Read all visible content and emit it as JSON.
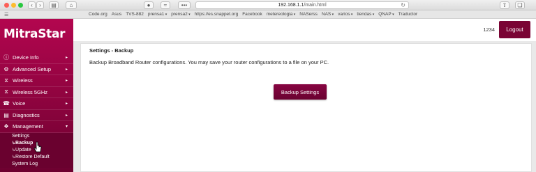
{
  "browser": {
    "url_host": "192.168.1.1",
    "url_path": "/main.html",
    "bookmarks": [
      {
        "label": "Code.org",
        "menu": false
      },
      {
        "label": "Asus",
        "menu": false
      },
      {
        "label": "TVS-882",
        "menu": false
      },
      {
        "label": "prensa1",
        "menu": true
      },
      {
        "label": "prensa2",
        "menu": true
      },
      {
        "label": "https://es.snappet.org",
        "menu": false
      },
      {
        "label": "Facebook",
        "menu": false
      },
      {
        "label": "metereologia",
        "menu": true
      },
      {
        "label": "NASerss",
        "menu": false
      },
      {
        "label": "NAS",
        "menu": true
      },
      {
        "label": "varios",
        "menu": true
      },
      {
        "label": "tiendas",
        "menu": true
      },
      {
        "label": "QNAP",
        "menu": true
      },
      {
        "label": "Traductor",
        "menu": false
      }
    ]
  },
  "brand": {
    "logo": "MitraStar",
    "color": "#a1044a"
  },
  "sidebar": {
    "items": [
      {
        "label": "Device Info",
        "icon": "info-icon"
      },
      {
        "label": "Advanced Setup",
        "icon": "gears-icon"
      },
      {
        "label": "Wireless",
        "icon": "wifi-icon"
      },
      {
        "label": "Wireless 5GHz",
        "icon": "wifi-icon"
      },
      {
        "label": "Voice",
        "icon": "phone-icon"
      },
      {
        "label": "Diagnostics",
        "icon": "chart-icon"
      },
      {
        "label": "Management",
        "icon": "wrench-icon"
      }
    ],
    "submenu": {
      "settings": "Settings",
      "backup": "Backup",
      "update": "Update",
      "restore": "Restore Default",
      "system_log": "System Log"
    }
  },
  "header": {
    "user": "1234",
    "logout": "Logout"
  },
  "content": {
    "title": "Settings - Backup",
    "description": "Backup Broadband Router configurations. You may save your router configurations to a file on your PC.",
    "button": "Backup Settings"
  }
}
